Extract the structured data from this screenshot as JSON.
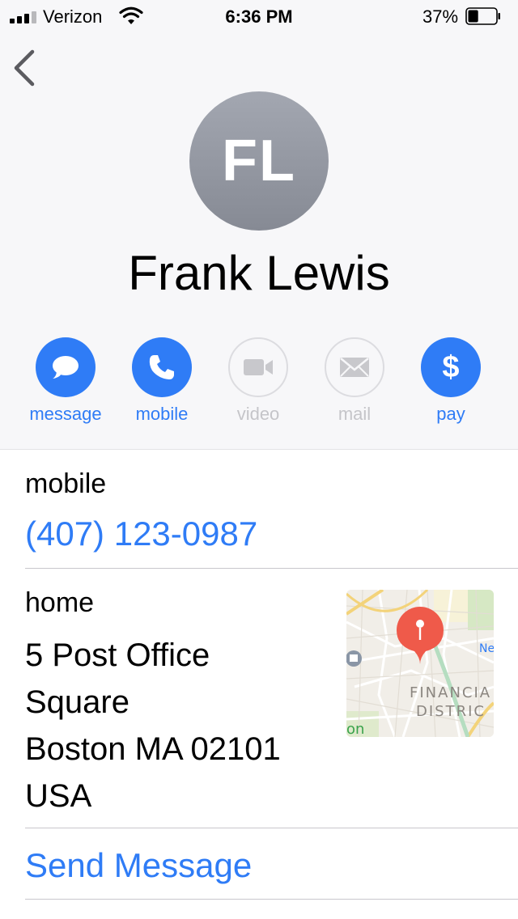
{
  "status_bar": {
    "carrier": "Verizon",
    "time": "6:36 PM",
    "battery_percent": "37%",
    "battery_level": 0.37,
    "signal_bars": 3,
    "signal_total": 4
  },
  "contact": {
    "initials": "FL",
    "name": "Frank Lewis"
  },
  "actions": [
    {
      "label": "message",
      "icon": "message-bubble-icon",
      "enabled": true
    },
    {
      "label": "mobile",
      "icon": "phone-icon",
      "enabled": true
    },
    {
      "label": "video",
      "icon": "video-camera-icon",
      "enabled": false
    },
    {
      "label": "mail",
      "icon": "envelope-icon",
      "enabled": false
    },
    {
      "label": "pay",
      "icon": "dollar-icon",
      "enabled": true,
      "symbol": "$"
    }
  ],
  "phone": {
    "label": "mobile",
    "number": "(407) 123-0987"
  },
  "address": {
    "label": "home",
    "lines": [
      "5 Post Office",
      "Square",
      "Boston MA 02101",
      "USA"
    ]
  },
  "map": {
    "labels": [
      "FINANCIA",
      "DISTRIC",
      "Ne",
      "on"
    ]
  },
  "send_message": "Send Message",
  "colors": {
    "accent": "#2f7cf6",
    "disabled": "#c5c5c9",
    "map_pin": "#ef5a4a"
  }
}
